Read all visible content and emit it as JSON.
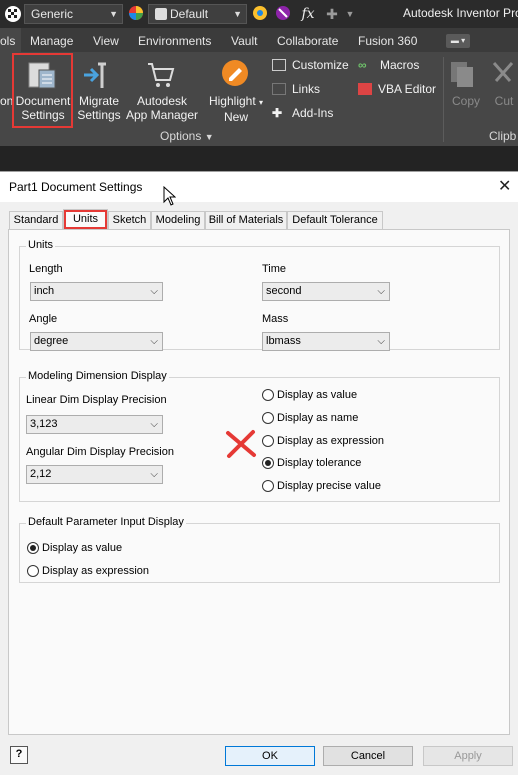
{
  "qat": {
    "material": "Generic",
    "appearance": "Default",
    "fx_label": "fx",
    "app_title": "Autodesk Inventor Pro"
  },
  "ribbon_tabs": [
    "ols",
    "Manage",
    "View",
    "Environments",
    "Vault",
    "Collaborate",
    "Fusion 360"
  ],
  "ribbon": {
    "cut_left_label": "on",
    "document_settings": [
      "Document",
      "Settings"
    ],
    "migrate_settings": [
      "Migrate",
      "Settings"
    ],
    "app_manager": [
      "Autodesk",
      "App Manager"
    ],
    "highlight_new": [
      "Highlight",
      "New"
    ],
    "customize": "Customize",
    "links": "Links",
    "add_ins": "Add-Ins",
    "macros": "Macros",
    "vba_editor": "VBA Editor",
    "copy": "Copy",
    "cut": "Cut",
    "options_group": "Options",
    "clipboard_group": "Clipb"
  },
  "dialog": {
    "title": "Part1 Document Settings",
    "tabs": [
      "Standard",
      "Units",
      "Sketch",
      "Modeling",
      "Bill of Materials",
      "Default Tolerance"
    ],
    "active_tab": "Units",
    "units_group": {
      "title": "Units",
      "length_label": "Length",
      "length_value": "inch",
      "time_label": "Time",
      "time_value": "second",
      "angle_label": "Angle",
      "angle_value": "degree",
      "mass_label": "Mass",
      "mass_value": "lbmass"
    },
    "modeling_group": {
      "title": "Modeling Dimension Display",
      "linear_label": "Linear Dim Display Precision",
      "linear_value": "3,123",
      "angular_label": "Angular Dim Display Precision",
      "angular_value": "2,12",
      "options": [
        {
          "label": "Display as value",
          "selected": false
        },
        {
          "label": "Display as name",
          "selected": false
        },
        {
          "label": "Display as expression",
          "selected": false
        },
        {
          "label": "Display tolerance",
          "selected": true
        },
        {
          "label": "Display precise value",
          "selected": false
        }
      ]
    },
    "param_group": {
      "title": "Default Parameter Input Display",
      "options": [
        {
          "label": "Display as value",
          "selected": true
        },
        {
          "label": "Display as expression",
          "selected": false
        }
      ]
    },
    "help": "?",
    "ok": "OK",
    "cancel": "Cancel",
    "apply": "Apply"
  },
  "colors": {
    "annotation_red": "#e53935",
    "ribbon_dark": "#474747"
  }
}
